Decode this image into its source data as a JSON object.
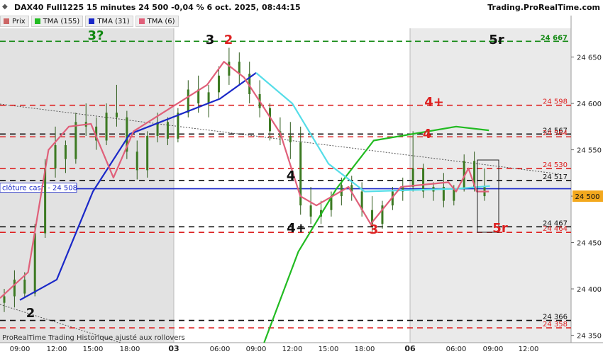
{
  "header": {
    "title": "DAX40 Full1225 15 minutes 24 500 -0,04 % 6 oct. 2025, 08:44:15",
    "brand": "Trading.ProRealTime.com"
  },
  "legend": [
    {
      "label": "Prix",
      "color": "#cc6666"
    },
    {
      "label": "TMA (155)",
      "color": "#22bb22"
    },
    {
      "label": "TMA (31)",
      "color": "#1a28c8"
    },
    {
      "label": "TMA (6)",
      "color": "#e0607a"
    }
  ],
  "footer_text": "ProRealTime Trading  Historique ajusté aux rollovers",
  "chart_data": {
    "type": "candlestick",
    "y_ticks": [
      "24 350",
      "24 400",
      "24 450",
      "24 500",
      "24 550",
      "24 600",
      "24 650"
    ],
    "ylim": [
      24342,
      24681
    ],
    "x_ticks": [
      "09:00",
      "12:00",
      "15:00",
      "18:00",
      "03",
      "06:00",
      "09:00",
      "12:00",
      "15:00",
      "18:00",
      "06",
      "06:00",
      "09:00",
      "12:00"
    ],
    "current_price": "24 500",
    "levels": [
      {
        "value": 24667,
        "label": "24 667",
        "color": "#118811",
        "style": "dashed-green"
      },
      {
        "value": 24598,
        "label": "24 598",
        "color": "#dd2222",
        "style": "dashed-red"
      },
      {
        "value": 24567,
        "label": "24 567",
        "color": "#111111",
        "style": "dashed-black"
      },
      {
        "value": 24564,
        "label": "24 564",
        "color": "#dd2222",
        "style": "dashed-red"
      },
      {
        "value": 24530,
        "label": "24 530",
        "color": "#dd2222",
        "style": "dashed-red"
      },
      {
        "value": 24517,
        "label": "24 517",
        "color": "#111111",
        "style": "dashed-black"
      },
      {
        "value": 24467,
        "label": "24 467",
        "color": "#111111",
        "style": "dashed-black"
      },
      {
        "value": 24461,
        "label": "24 464",
        "color": "#dd2222",
        "style": "dashed-red"
      },
      {
        "value": 24366,
        "label": "24 366",
        "color": "#111111",
        "style": "dashed-black"
      },
      {
        "value": 24358,
        "label": "24 358",
        "color": "#dd2222",
        "style": "dashed-red"
      }
    ],
    "cloture_cash": {
      "label": "clôture cash -  24 508",
      "value": 24508,
      "color": "#1a28c8"
    },
    "annotations": [
      {
        "text": "3?",
        "color": "#118811"
      },
      {
        "text": "3",
        "color": "#111111"
      },
      {
        "text": "2",
        "color": "#dd2222"
      },
      {
        "text": "5r",
        "color": "#111111"
      },
      {
        "text": "4+",
        "color": "#dd2222"
      },
      {
        "text": "4",
        "color": "#dd2222"
      },
      {
        "text": "4",
        "color": "#111111"
      },
      {
        "text": "4+",
        "color": "#111111"
      },
      {
        "text": "3",
        "color": "#dd2222"
      },
      {
        "text": "5r",
        "color": "#dd2222"
      },
      {
        "text": "2",
        "color": "#111111"
      }
    ],
    "tma155": {
      "name": "TMA (155)",
      "color": "#22bb22",
      "x": [
        "03 09:40",
        "03 12:30",
        "03 15:40",
        "03 18:30",
        "06 06:00",
        "06 08:40"
      ],
      "y": [
        24342,
        24440,
        24508,
        24560,
        24575,
        24571
      ]
    },
    "tma31": {
      "name": "TMA (31)",
      "color": "#1a28c8",
      "x": [
        "02 09:00",
        "02 12:00",
        "02 15:00",
        "02 18:00",
        "03 06:00",
        "03 09:00"
      ],
      "y": [
        24388,
        24410,
        24505,
        24567,
        24605,
        24633
      ]
    },
    "tma31_ext": {
      "name": "TMA (31)",
      "color": "#55dde8",
      "x": [
        "03 09:00",
        "03 12:00",
        "03 15:00",
        "03 18:00",
        "06 06:00",
        "06 08:45"
      ],
      "y": [
        24633,
        24600,
        24535,
        24505,
        24508,
        24511
      ]
    },
    "tma6": {
      "name": "TMA (6)",
      "color": "#e0607a",
      "x": [
        "02 08:00",
        "02 09:40",
        "02 11:20",
        "02 13:00",
        "02 14:50",
        "02 16:40",
        "02 18:30",
        "03 04:20",
        "03 06:20",
        "03 08:00",
        "03 09:40",
        "03 11:00",
        "03 12:40",
        "03 14:00",
        "03 15:20",
        "03 16:40",
        "03 18:20",
        "03 20:00",
        "06 05:00",
        "06 06:00",
        "06 07:00",
        "06 07:40",
        "06 08:40"
      ],
      "y": [
        24390,
        24418,
        24550,
        24575,
        24578,
        24520,
        24570,
        24620,
        24645,
        24628,
        24595,
        24568,
        24500,
        24490,
        24500,
        24510,
        24470,
        24510,
        24515,
        24505,
        24530,
        24505,
        24505
      ]
    },
    "candles_ohlc": [
      [
        24385,
        24400,
        24375,
        24392
      ],
      [
        24392,
        24420,
        24380,
        24410
      ],
      [
        24410,
        24418,
        24390,
        24395
      ],
      [
        24395,
        24470,
        24392,
        24460
      ],
      [
        24460,
        24540,
        24455,
        24530
      ],
      [
        24530,
        24575,
        24520,
        24555
      ],
      [
        24555,
        24560,
        24525,
        24540
      ],
      [
        24540,
        24590,
        24535,
        24580
      ],
      [
        24580,
        24600,
        24565,
        24575
      ],
      [
        24575,
        24585,
        24550,
        24560
      ],
      [
        24560,
        24600,
        24555,
        24590
      ],
      [
        24590,
        24620,
        24575,
        24585
      ],
      [
        24585,
        24592,
        24540,
        24548
      ],
      [
        24548,
        24560,
        24518,
        24528
      ],
      [
        24528,
        24570,
        24520,
        24565
      ],
      [
        24565,
        24590,
        24558,
        24580
      ],
      [
        24580,
        24585,
        24555,
        24562
      ],
      [
        24562,
        24595,
        24558,
        24590
      ],
      [
        24590,
        24625,
        24585,
        24615
      ],
      [
        24615,
        24630,
        24590,
        24600
      ],
      [
        24600,
        24620,
        24585,
        24612
      ],
      [
        24612,
        24640,
        24605,
        24630
      ],
      [
        24630,
        24660,
        24620,
        24645
      ],
      [
        24645,
        24655,
        24620,
        24632
      ],
      [
        24632,
        24645,
        24600,
        24610
      ],
      [
        24610,
        24625,
        24585,
        24595
      ],
      [
        24595,
        24600,
        24560,
        24570
      ],
      [
        24570,
        24585,
        24555,
        24565
      ],
      [
        24565,
        24580,
        24540,
        24558
      ],
      [
        24558,
        24575,
        24480,
        24490
      ],
      [
        24490,
        24510,
        24470,
        24478
      ],
      [
        24478,
        24495,
        24470,
        24485
      ],
      [
        24485,
        24505,
        24478,
        24500
      ],
      [
        24500,
        24520,
        24490,
        24512
      ],
      [
        24512,
        24522,
        24495,
        24505
      ],
      [
        24505,
        24515,
        24478,
        24485
      ],
      [
        24485,
        24500,
        24462,
        24470
      ],
      [
        24470,
        24495,
        24465,
        24490
      ],
      [
        24490,
        24510,
        24485,
        24505
      ],
      [
        24505,
        24520,
        24495,
        24510
      ],
      [
        24510,
        24570,
        24505,
        24530
      ],
      [
        24530,
        24535,
        24498,
        24505
      ],
      [
        24505,
        24515,
        24495,
        24510
      ],
      [
        24510,
        24525,
        24488,
        24495
      ],
      [
        24495,
        24512,
        24490,
        24508
      ],
      [
        24508,
        24545,
        24505,
        24538
      ],
      [
        24538,
        24548,
        24505,
        24510
      ],
      [
        24510,
        24530,
        24495,
        24500
      ]
    ]
  }
}
